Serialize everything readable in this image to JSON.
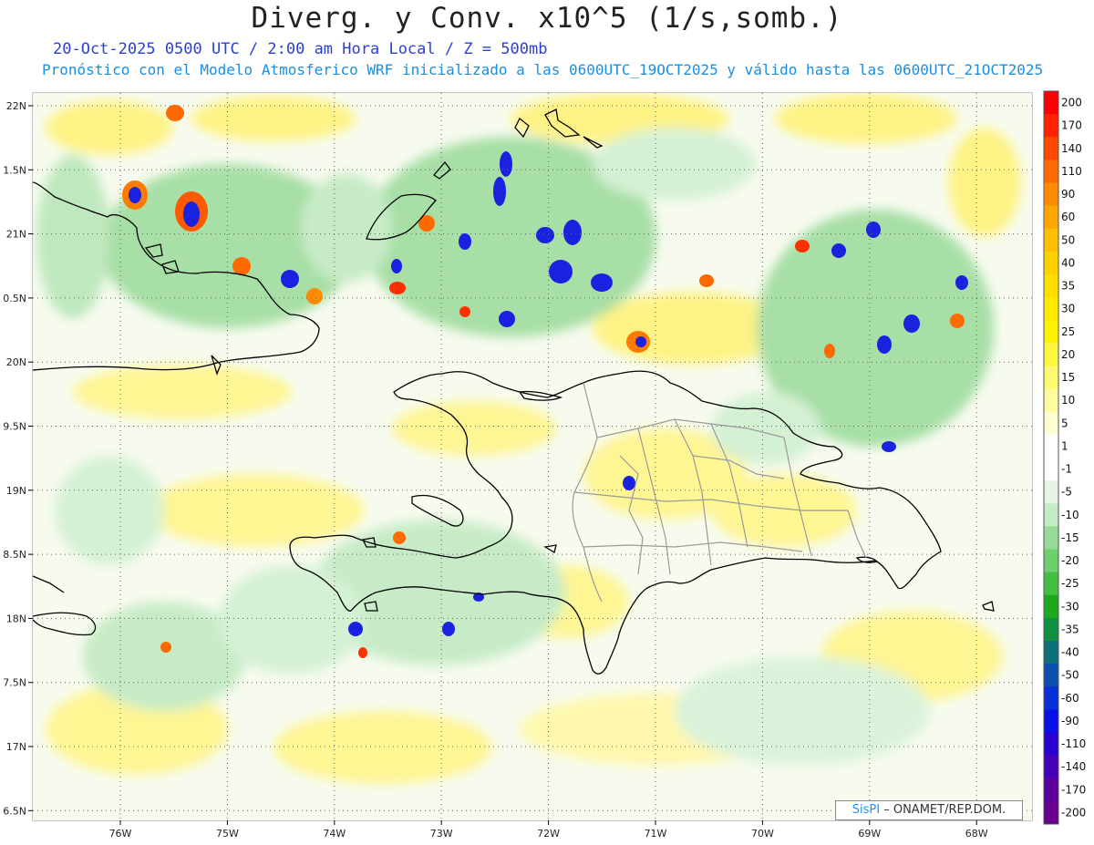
{
  "header": {
    "title": "Diverg. y Conv. x10^5 (1/s,somb.)",
    "valid_line": "20-Oct-2025  0500 UTC / 2:00 am Hora Local / Z = 500mb",
    "model_line": "Pronóstico con el Modelo Atmosferico WRF inicializado a las 0600UTC_19OCT2025 y válido hasta las  0600UTC_21OCT2025"
  },
  "map": {
    "lat_labels": [
      "22N",
      "1.5N",
      "21N",
      "0.5N",
      "20N",
      "9.5N",
      "19N",
      "8.5N",
      "18N",
      "7.5N",
      "17N",
      "6.5N"
    ],
    "lon_labels": [
      "76W",
      "75W",
      "74W",
      "73W",
      "72W",
      "71W",
      "70W",
      "69W",
      "68W"
    ]
  },
  "colorbar": {
    "labels": [
      "200",
      "170",
      "140",
      "110",
      "90",
      "60",
      "50",
      "40",
      "35",
      "30",
      "25",
      "20",
      "15",
      "10",
      "5",
      "1",
      "-1",
      "-5",
      "-10",
      "-15",
      "-20",
      "-25",
      "-30",
      "-35",
      "-40",
      "-50",
      "-60",
      "-90",
      "-110",
      "-140",
      "-170",
      "-200"
    ],
    "colors": [
      "#ff0000",
      "#ff2200",
      "#ff4800",
      "#ff6a00",
      "#ff8c00",
      "#ffa800",
      "#ffbe00",
      "#ffd000",
      "#ffdf00",
      "#ffea00",
      "#fff200",
      "#fff640",
      "#fffa70",
      "#fffca0",
      "#fffed0",
      "#ffffff",
      "#ffffff",
      "#e6f5e6",
      "#c6ecc6",
      "#98db98",
      "#6ecf6e",
      "#44bf44",
      "#1ea81e",
      "#0f8f3f",
      "#0e6e7a",
      "#0d4fb0",
      "#0a2fd8",
      "#0a10e8",
      "#2800d0",
      "#4600b8",
      "#5a00a0",
      "#6a0090"
    ]
  },
  "credit": {
    "brand": "SisPI",
    "text": " – ONAMET/REP.DOM."
  }
}
